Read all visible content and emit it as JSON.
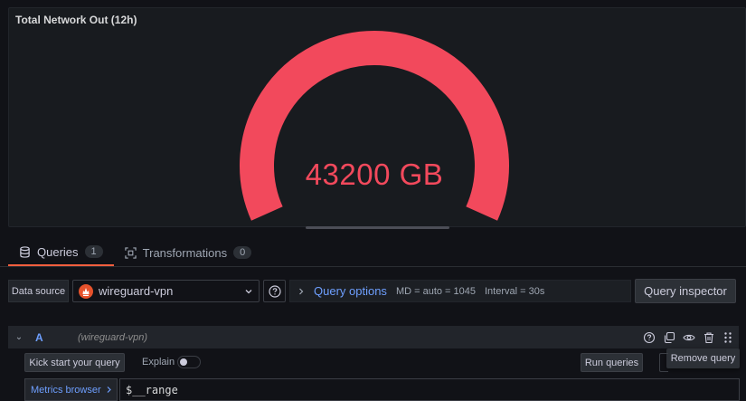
{
  "panel": {
    "title": "Total Network Out (12h)",
    "gauge_value": "43200 GB",
    "gauge_fill_fraction": 1.0,
    "colors": {
      "value": "#f2495c",
      "threshold_low": "#e0b400"
    }
  },
  "tabs": [
    {
      "label": "Queries",
      "count": "1",
      "icon": "database-icon"
    },
    {
      "label": "Transformations",
      "count": "0",
      "icon": "transform-icon"
    }
  ],
  "toolbar": {
    "data_source_label": "Data source",
    "data_source_value": "wireguard-vpn",
    "query_options": {
      "title": "Query options",
      "md": "MD = auto = 1045",
      "interval": "Interval = 30s"
    },
    "query_inspector_label": "Query inspector"
  },
  "query": {
    "ref_id": "A",
    "datasource_name": "(wireguard-vpn)",
    "tooltip": "Remove query",
    "kick_start_label": "Kick start your query",
    "explain_label": "Explain",
    "explain_on": false,
    "run_label": "Run queries",
    "metrics_browser_label": "Metrics browser",
    "expression": "$__range"
  },
  "accent": {
    "active_tab": "#f55f3e",
    "link": "#6e9fff"
  }
}
